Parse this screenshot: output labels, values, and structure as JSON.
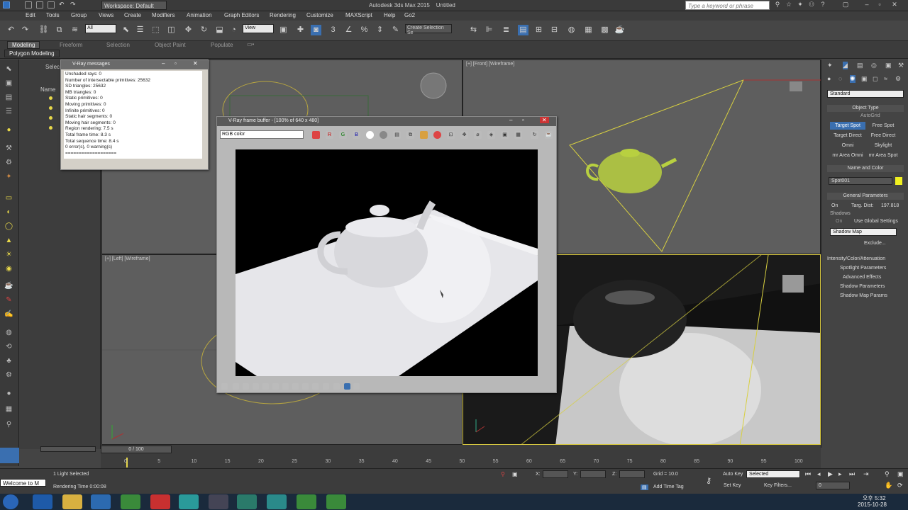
{
  "app": {
    "title": "Autodesk 3ds Max  2015",
    "doc": "Untitled",
    "workspace": "Workspace: Default",
    "search_placeholder": "Type a keyword or phrase"
  },
  "menu": [
    "Edit",
    "Tools",
    "Group",
    "Views",
    "Create",
    "Modifiers",
    "Animation",
    "Graph Editors",
    "Rendering",
    "Customize",
    "MAXScript",
    "Help",
    "Go2"
  ],
  "toolbar": {
    "filter": "All",
    "view": "View",
    "selset": "Create Selection Se"
  },
  "ribbon": {
    "tabs": [
      "Modeling",
      "Freeform",
      "Selection",
      "Object Paint",
      "Populate"
    ],
    "sub": "Polygon Modeling"
  },
  "scene_explorer": {
    "select": "Selec",
    "name_col": "Name"
  },
  "viewports": {
    "front": "[+] [Front] [Wireframe]",
    "left": "[+] [Left] [Wireframe]"
  },
  "vray_messages": {
    "title": "V-Ray messages",
    "lines": [
      "Unshaded rays: 0",
      "Number of intersectable primitives: 25632",
      "SD triangles: 25632",
      "MB triangles: 0",
      "Static primitives: 0",
      "Moving primitives: 0",
      "Infinite primitives: 0",
      "Static hair segments: 0",
      "Moving hair segments: 0",
      "Region rendering: 7.5 s",
      "Total frame time: 8.3 s",
      "Total sequence time: 8.4 s",
      "0 error(s), 0 warning(s)",
      "==================="
    ]
  },
  "frame_buffer": {
    "title": "V-Ray frame buffer - [100% of 640 x 480]",
    "channel": "RGB color",
    "rgb": [
      "R",
      "G",
      "B"
    ]
  },
  "command_panel": {
    "standard": "Standard",
    "object_type": "Object Type",
    "autogrid": "AutoGrid",
    "lights": [
      "Target Spot",
      "Free Spot",
      "Target Direct",
      "Free Direct",
      "Omni",
      "Skylight",
      "mr Area Omni",
      "mr Area Spot"
    ],
    "name_and_color": "Name and Color",
    "obj_name": "Spot001",
    "obj_color": "#f0f020",
    "general_params": "General Parameters",
    "on": "On",
    "targ_dist_label": "Targ. Dist:",
    "targ_dist": "197.818",
    "shadows": "Shadows",
    "use_global": "Use Global Settings",
    "shadow_type": "Shadow Map",
    "exclude": "Exclude...",
    "rollouts": [
      "Intensity/Color/Attenuation",
      "Spotlight Parameters",
      "Advanced Effects",
      "Shadow Parameters",
      "Shadow Map Params"
    ]
  },
  "timeline": {
    "frame": "0 / 100",
    "ticks": [
      "0",
      "5",
      "10",
      "15",
      "20",
      "25",
      "30",
      "35",
      "40",
      "45",
      "50",
      "55",
      "60",
      "65",
      "70",
      "75",
      "80",
      "85",
      "90",
      "95",
      "100"
    ]
  },
  "status": {
    "welcome": "Welcome to M",
    "selected": "1 Light Selected",
    "render_time": "Rendering Time  0:00:08",
    "x": "X:",
    "y": "Y:",
    "z": "Z:",
    "grid": "Grid = 10.0",
    "add_time_tag": "Add Time Tag",
    "auto_key": "Auto Key",
    "set_key": "Set Key",
    "selected_dd": "Selected",
    "key_filters": "Key Filters...",
    "frame_field": "0"
  },
  "taskbar": {
    "time": "오후 5:32",
    "date": "2015-10-28"
  }
}
